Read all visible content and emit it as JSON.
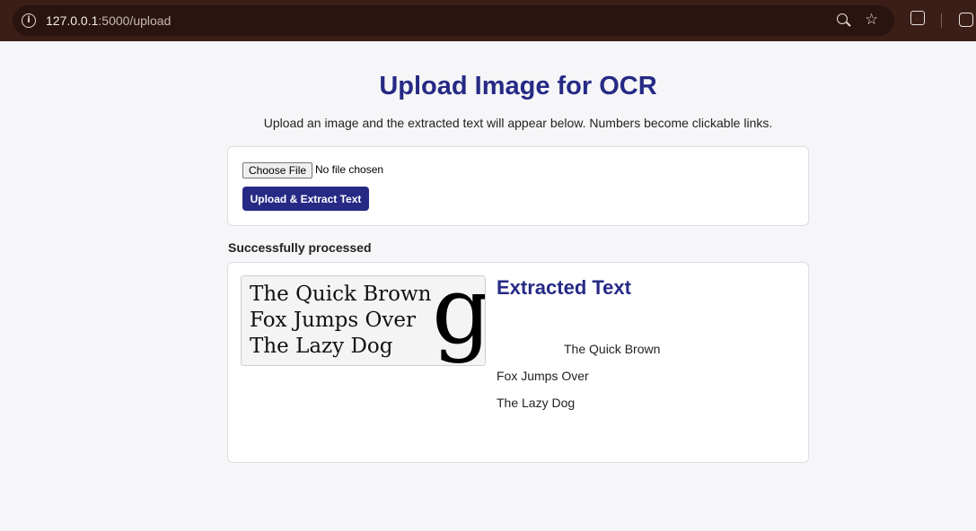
{
  "browser": {
    "url_host": "127.0.0.1",
    "url_path": ":5000/upload",
    "info_icon": "info-icon",
    "zoom_icon": "zoom-icon",
    "star_icon": "star-icon",
    "extensions_icon": "puzzle-icon",
    "camera_icon": "camera-icon"
  },
  "page": {
    "title": "Upload Image for OCR",
    "subtitle": "Upload an image and the extracted text will appear below. Numbers become clickable links."
  },
  "upload": {
    "choose_file_label": "Choose File",
    "file_status": "No file chosen",
    "submit_label": "Upload & Extract Text"
  },
  "status_message": "Successfully processed",
  "result": {
    "image": {
      "lines": [
        "The Quick Brown",
        "Fox Jumps Over",
        "The Lazy Dog"
      ],
      "glyph": "g"
    },
    "heading": "Extracted Text",
    "lines": [
      "The Quick Brown",
      "Fox Jumps Over",
      "The Lazy Dog"
    ]
  },
  "colors": {
    "accent": "#262a85",
    "chrome": "#3b1f17",
    "page_bg": "#f6f6f8"
  }
}
